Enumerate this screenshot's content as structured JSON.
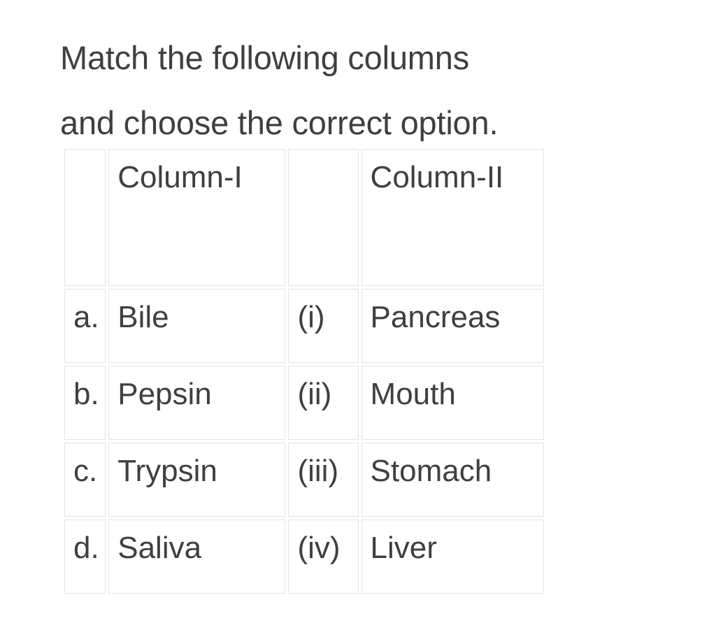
{
  "heading": {
    "line1": "Match the following columns",
    "line2": "and choose the correct option.",
    "full": "Match the following columns\nand choose the correct option."
  },
  "colors": {
    "text": "#3f3f3f",
    "border": "#e4e4e4",
    "background": "#ffffff"
  },
  "table": {
    "header": {
      "key_label": "",
      "column_one": "Column-I",
      "roman_label": "",
      "column_two": "Column-II"
    },
    "rows": [
      {
        "key": "a.",
        "column_one": "Bile",
        "roman": "(i)",
        "column_two": "Pancreas"
      },
      {
        "key": "b.",
        "column_one": "Pepsin",
        "roman": "(ii)",
        "column_two": "Mouth"
      },
      {
        "key": "c.",
        "column_one": "Trypsin",
        "roman": "(iii)",
        "column_two": "Stomach"
      },
      {
        "key": "d.",
        "column_one": "Saliva",
        "roman": "(iv)",
        "column_two": "Liver"
      }
    ]
  }
}
